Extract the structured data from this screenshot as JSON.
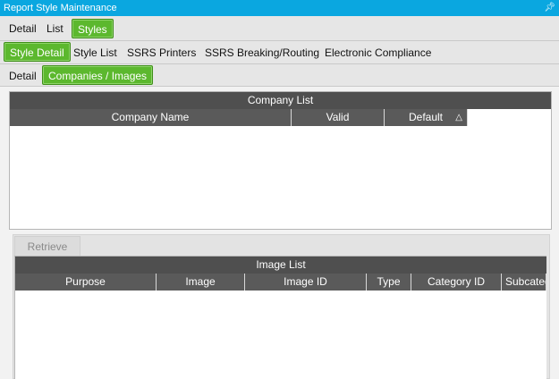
{
  "window": {
    "title": "Report Style Maintenance",
    "pin_icon": "pin-icon"
  },
  "top_tabs": [
    {
      "label": "Detail"
    },
    {
      "label": "List"
    },
    {
      "label": "Styles",
      "active": true
    }
  ],
  "style_tabs": [
    {
      "label": "Style Detail",
      "active": true
    },
    {
      "label": "Style List"
    },
    {
      "label": "SSRS Printers"
    },
    {
      "label": "SSRS Breaking/Routing"
    },
    {
      "label": "Electronic Compliance"
    }
  ],
  "detail_tabs": [
    {
      "label": "Detail"
    },
    {
      "label": "Companies / Images",
      "active": true
    }
  ],
  "company_list": {
    "caption": "Company List",
    "columns": [
      "Company Name",
      "Valid",
      "Default"
    ],
    "sort_icon": "sort-ascending-icon",
    "sort_glyph": "△"
  },
  "retrieve_button": {
    "label": "Retrieve"
  },
  "image_list": {
    "caption": "Image List",
    "columns": [
      "Purpose",
      "Image",
      "Image ID",
      "Type",
      "Category ID",
      "Subcateg"
    ]
  }
}
